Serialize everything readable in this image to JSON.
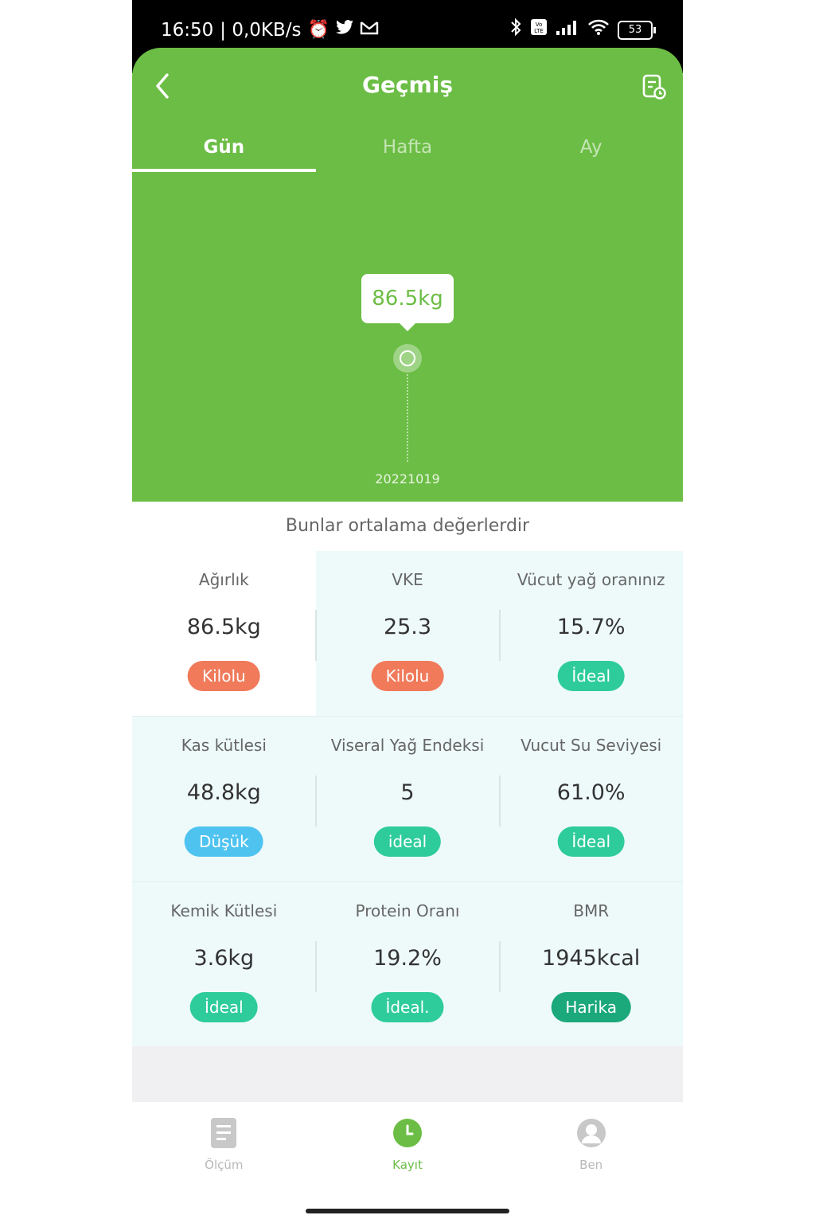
{
  "status_bar": {
    "time": "16:50",
    "network_speed": "| 0,0KB/s",
    "battery": "53",
    "icons": [
      "alarm-icon",
      "twitter-icon",
      "gmail-icon",
      "bluetooth-icon",
      "volte-icon",
      "signal-icon",
      "wifi-icon",
      "battery-icon"
    ]
  },
  "header": {
    "title": "Geçmiş",
    "back_icon": "chevron-left-icon",
    "report_icon": "report-icon"
  },
  "tabs": [
    {
      "label": "Gün",
      "active": true
    },
    {
      "label": "Hafta",
      "active": false
    },
    {
      "label": "Ay",
      "active": false
    }
  ],
  "chart_data": {
    "type": "scatter",
    "x": [
      "20221019"
    ],
    "values": [
      86.5
    ],
    "tooltip": "86.5kg",
    "accent": "#6cbd45"
  },
  "summary_note": "Bunlar ortalama değerlerdir",
  "metrics": [
    [
      {
        "label": "Ağırlık",
        "value": "86.5kg",
        "status": "Kilolu",
        "color": "#f07a5a"
      },
      {
        "label": "VKE",
        "value": "25.3",
        "status": "Kilolu",
        "color": "#f07a5a"
      },
      {
        "label": "Vücut yağ oranınız",
        "value": "15.7%",
        "status": "İdeal",
        "color": "#2ecc9a"
      }
    ],
    [
      {
        "label": "Kas kütlesi",
        "value": "48.8kg",
        "status": "Düşük",
        "color": "#4fc3f0"
      },
      {
        "label": "Viseral Yağ Endeksi",
        "value": "5",
        "status": "ideal",
        "color": "#2ecc9a"
      },
      {
        "label": "Vucut Su Seviyesi",
        "value": "61.0%",
        "status": "İdeal",
        "color": "#2ecc9a"
      }
    ],
    [
      {
        "label": "Kemik Kütlesi",
        "value": "3.6kg",
        "status": "İdeal",
        "color": "#2ecc9a"
      },
      {
        "label": "Protein Oranı",
        "value": "19.2%",
        "status": "İdeal.",
        "color": "#2ecc9a"
      },
      {
        "label": "BMR",
        "value": "1945kcal",
        "status": "Harika",
        "color": "#1ba87a"
      }
    ]
  ],
  "bottom_nav": [
    {
      "label": "Ölçüm",
      "icon": "document-icon",
      "active": false
    },
    {
      "label": "Kayıt",
      "icon": "clock-icon",
      "active": true
    },
    {
      "label": "Ben",
      "icon": "user-icon",
      "active": false
    }
  ]
}
